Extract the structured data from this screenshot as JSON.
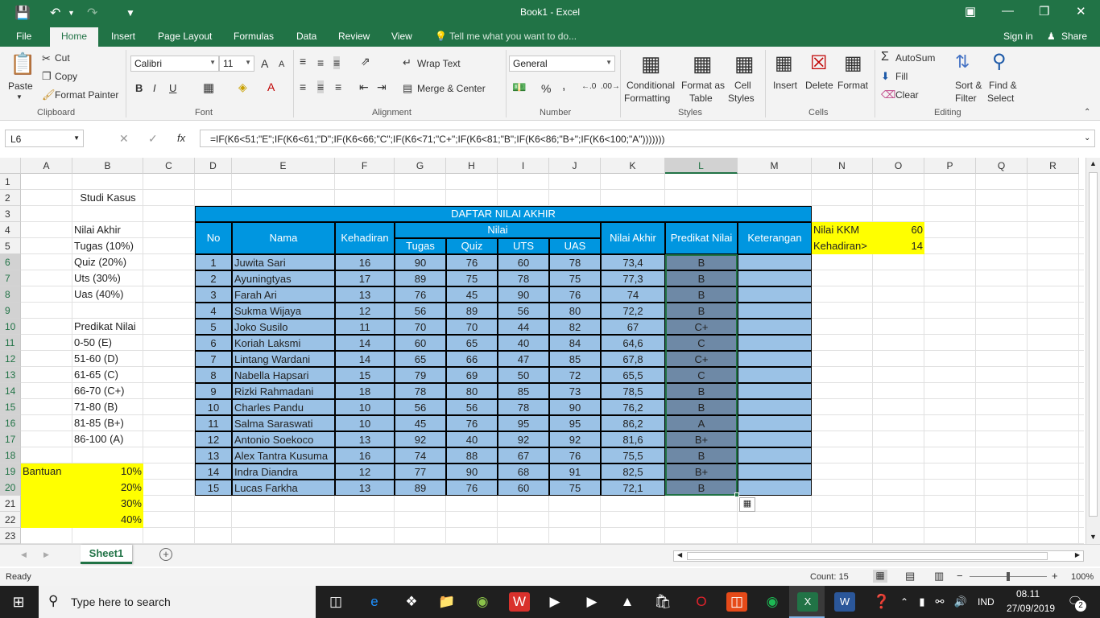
{
  "app": {
    "title": "Book1 - Excel",
    "signin": "Sign in",
    "share": "Share",
    "tellme": "Tell me what you want to do..."
  },
  "tabs": [
    "File",
    "Home",
    "Insert",
    "Page Layout",
    "Formulas",
    "Data",
    "Review",
    "View"
  ],
  "ribbon": {
    "clipboard": {
      "paste": "Paste",
      "cut": "Cut",
      "copy": "Copy",
      "format_painter": "Format Painter",
      "label": "Clipboard"
    },
    "font": {
      "name": "Calibri",
      "size": "11",
      "label": "Font",
      "bold": "B",
      "italic": "I",
      "underline": "U",
      "grow": "A",
      "shrink": "A"
    },
    "alignment": {
      "wrap": "Wrap Text",
      "merge": "Merge & Center",
      "label": "Alignment"
    },
    "number": {
      "format": "General",
      "percent": "%",
      "comma": ",",
      "label": "Number"
    },
    "styles": {
      "conditional1": "Conditional",
      "conditional2": "Formatting",
      "table1": "Format as",
      "table2": "Table",
      "cell1": "Cell",
      "cell2": "Styles",
      "label": "Styles"
    },
    "cells": {
      "insert": "Insert",
      "delete": "Delete",
      "format": "Format",
      "label": "Cells"
    },
    "editing": {
      "autosum": "AutoSum",
      "fill": "Fill",
      "clear": "Clear",
      "sort1": "Sort &",
      "sort2": "Filter",
      "find1": "Find &",
      "find2": "Select",
      "label": "Editing"
    }
  },
  "formula_bar": {
    "name_box": "L6",
    "formula": "=IF(K6<51;\"E\";IF(K6<61;\"D\";IF(K6<66;\"C\";IF(K6<71;\"C+\";IF(K6<81;\"B\";IF(K6<86;\"B+\";IF(K6<100;\"A\")))))))",
    "fx": "fx"
  },
  "columns": [
    "A",
    "B",
    "C",
    "D",
    "E",
    "F",
    "G",
    "H",
    "I",
    "J",
    "K",
    "L",
    "M",
    "N",
    "O",
    "P",
    "Q",
    "R"
  ],
  "rows": [
    "1",
    "2",
    "3",
    "4",
    "5",
    "6",
    "7",
    "8",
    "9",
    "10",
    "11",
    "12",
    "13",
    "14",
    "15",
    "16",
    "17",
    "18",
    "19",
    "20",
    "21",
    "22",
    "23"
  ],
  "sheet": {
    "studi_kasus": "Studi Kasus",
    "left_labels": [
      "Nilai Akhir",
      "Tugas (10%)",
      "Quiz   (20%)",
      "Uts     (30%)",
      "Uas     (40%)",
      "",
      "Predikat Nilai",
      "0-50    (E)",
      "51-60   (D)",
      "61-65   (C)",
      "66-70   (C+)",
      "71-80   (B)",
      "81-85   (B+)",
      "86-100  (A)"
    ],
    "bantuan_label": "Bantuan",
    "bantuan": [
      "10%",
      "20%",
      "30%",
      "40%"
    ],
    "table_title": "DAFTAR NILAI AKHIR",
    "headers": {
      "no": "No",
      "nama": "Nama",
      "kehadiran": "Kehadiran",
      "nilai": "Nilai",
      "tugas": "Tugas",
      "quiz": "Quiz",
      "uts": "UTS",
      "uas": "UAS",
      "nilai_akhir": "Nilai Akhir",
      "predikat": "Predikat Nilai",
      "keterangan": "Keterangan"
    },
    "kkm_label": "Nilai KKM",
    "kkm_value": "60",
    "kehadiran_label": "Kehadiran>",
    "kehadiran_value": "14",
    "data": [
      [
        "1",
        "Juwita Sari",
        "16",
        "90",
        "76",
        "60",
        "78",
        "73,4",
        "B"
      ],
      [
        "2",
        "Ayuningtyas",
        "17",
        "89",
        "75",
        "78",
        "75",
        "77,3",
        "B"
      ],
      [
        "3",
        "Farah Ari",
        "13",
        "76",
        "45",
        "90",
        "76",
        "74",
        "B"
      ],
      [
        "4",
        "Sukma Wijaya",
        "12",
        "56",
        "89",
        "56",
        "80",
        "72,2",
        "B"
      ],
      [
        "5",
        "Joko Susilo",
        "11",
        "70",
        "70",
        "44",
        "82",
        "67",
        "C+"
      ],
      [
        "6",
        "Koriah Laksmi",
        "14",
        "60",
        "65",
        "40",
        "84",
        "64,6",
        "C"
      ],
      [
        "7",
        "Lintang Wardani",
        "14",
        "65",
        "66",
        "47",
        "85",
        "67,8",
        "C+"
      ],
      [
        "8",
        "Nabella Hapsari",
        "15",
        "79",
        "69",
        "50",
        "72",
        "65,5",
        "C"
      ],
      [
        "9",
        "Rizki Rahmadani",
        "18",
        "78",
        "80",
        "85",
        "73",
        "78,5",
        "B"
      ],
      [
        "10",
        "Charles Pandu",
        "10",
        "56",
        "56",
        "78",
        "90",
        "76,2",
        "B"
      ],
      [
        "11",
        "Salma Saraswati",
        "10",
        "45",
        "76",
        "95",
        "95",
        "86,2",
        "A"
      ],
      [
        "12",
        "Antonio Soekoco",
        "13",
        "92",
        "40",
        "92",
        "92",
        "81,6",
        "B+"
      ],
      [
        "13",
        "Alex Tantra Kusuma",
        "16",
        "74",
        "88",
        "67",
        "76",
        "75,5",
        "B"
      ],
      [
        "14",
        "Indra Diandra",
        "12",
        "77",
        "90",
        "68",
        "91",
        "82,5",
        "B+"
      ],
      [
        "15",
        "Lucas Farkha",
        "13",
        "89",
        "76",
        "60",
        "75",
        "72,1",
        "B"
      ]
    ]
  },
  "sheet_tabs": {
    "active": "Sheet1",
    "add": "+"
  },
  "status": {
    "ready": "Ready",
    "count": "Count: 15",
    "zoom": "100%"
  },
  "taskbar": {
    "search": "Type here to search",
    "time": "08.11",
    "date": "27/09/2019",
    "lang": "IND",
    "notif": "2"
  },
  "colors": {
    "excel_green": "#217346",
    "table_blue": "#9bc2e6",
    "header_blue": "#0096e0",
    "highlight": "#ffff00"
  }
}
